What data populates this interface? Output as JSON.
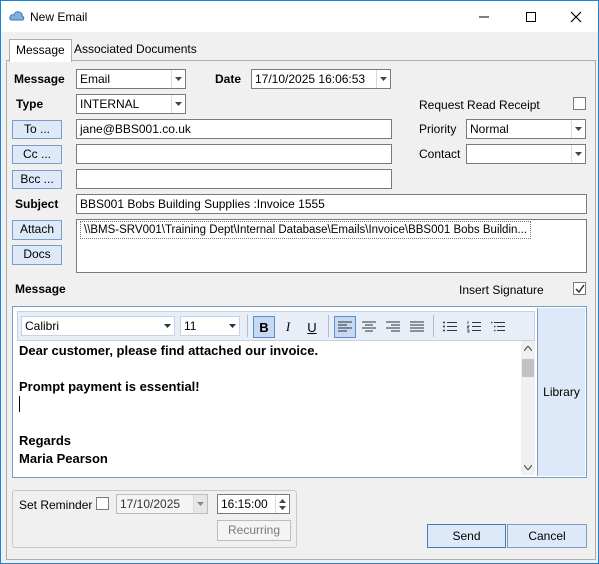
{
  "window": {
    "title": "New Email",
    "app_icon": "cloud-icon",
    "controls": [
      "minimize-icon",
      "maximize-icon",
      "close-icon"
    ]
  },
  "tabs": [
    {
      "label": "Message",
      "active": true
    },
    {
      "label": "Associated Documents",
      "active": false
    }
  ],
  "form": {
    "message_label": "Message",
    "message_type_value": "Email",
    "date_label": "Date",
    "date_value": "17/10/2025 16:06:53",
    "type_label": "Type",
    "type_value": "INTERNAL",
    "read_receipt_label": "Request Read Receipt",
    "read_receipt_checked": false,
    "to_button": "To ...",
    "to_value": "jane@BBS001.co.uk",
    "cc_button": "Cc ...",
    "cc_value": "",
    "bcc_button": "Bcc ...",
    "bcc_value": "",
    "priority_label": "Priority",
    "priority_value": "Normal",
    "contact_label": "Contact",
    "contact_value": "",
    "subject_label": "Subject",
    "subject_value": "BBS001 Bobs Building Supplies :Invoice 1555",
    "attach_button": "Attach",
    "docs_button": "Docs",
    "attachment_path": "\\\\BMS-SRV001\\Training Dept\\Internal Database\\Emails\\Invoice\\BBS001 Bobs Buildin..."
  },
  "editor": {
    "section_label": "Message",
    "insert_signature_label": "Insert Signature",
    "insert_signature_checked": true,
    "font_name": "Calibri",
    "font_size": "11",
    "bold_active": true,
    "lines": [
      "Dear customer, please find attached our invoice.",
      "",
      "Prompt payment is essential!",
      "",
      "",
      "Regards",
      "Maria Pearson"
    ],
    "library_button": "Library"
  },
  "reminder": {
    "label": "Set Reminder",
    "checked": false,
    "date_value": "17/10/2025",
    "time_value": "16:15:00",
    "recurring_button": "Recurring"
  },
  "actions": {
    "send": "Send",
    "cancel": "Cancel"
  }
}
